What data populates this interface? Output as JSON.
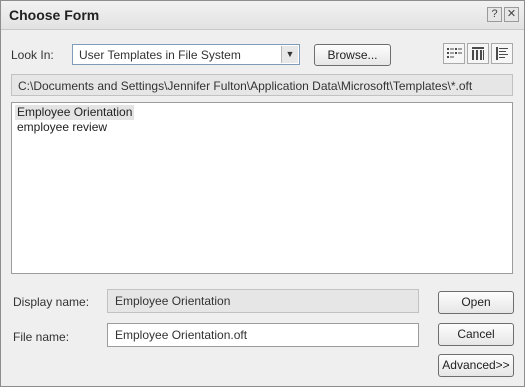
{
  "dialog": {
    "title": "Choose Form",
    "help_glyph": "?",
    "close_glyph": "✕"
  },
  "look_in": {
    "label": "Look In:",
    "value": "User Templates in File System",
    "arrow_glyph": "▼"
  },
  "browse_button": "Browse...",
  "view_buttons": [
    "list-view-icon",
    "details-view-icon",
    "properties-view-icon"
  ],
  "path": "C:\\Documents and Settings\\Jennifer Fulton\\Application Data\\Microsoft\\Templates\\*.oft",
  "files": [
    {
      "name": "Employee Orientation",
      "selected": true
    },
    {
      "name": "employee review",
      "selected": false
    }
  ],
  "display_name": {
    "label": "Display name:",
    "value": "Employee Orientation"
  },
  "file_name": {
    "label": "File name:",
    "value": "Employee Orientation.oft"
  },
  "buttons": {
    "open": "Open",
    "cancel": "Cancel",
    "advanced": "Advanced>>"
  }
}
